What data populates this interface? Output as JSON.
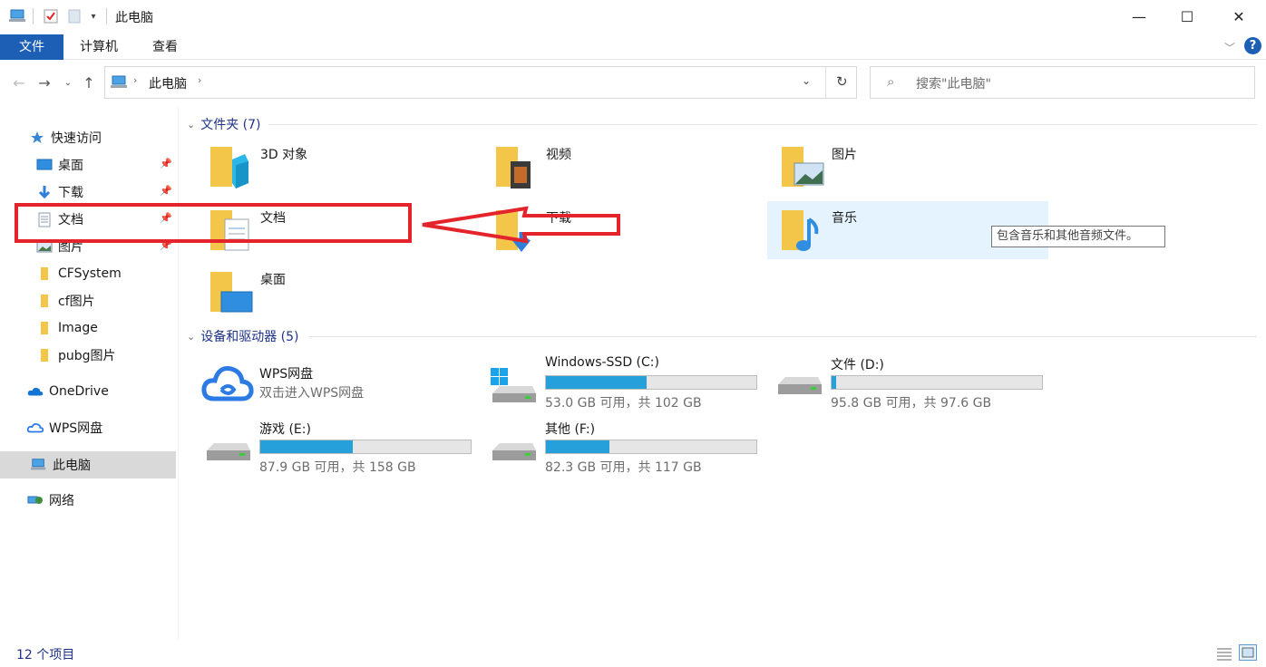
{
  "window": {
    "title": "此电脑",
    "controls": {
      "minimize": "—",
      "maximize": "☐",
      "close": "✕"
    }
  },
  "ribbon": {
    "tabs": [
      "文件",
      "计算机",
      "查看"
    ],
    "help": "?"
  },
  "address": {
    "path": "此电脑",
    "search_placeholder": "搜索\"此电脑\""
  },
  "sidebar": {
    "quick_access": "快速访问",
    "pinned": [
      "桌面",
      "下载",
      "文档",
      "图片"
    ],
    "folders": [
      "CFSystem",
      "cf图片",
      "Image",
      "pubg图片"
    ],
    "onedrive": "OneDrive",
    "wps": "WPS网盘",
    "this_pc": "此电脑",
    "network": "网络"
  },
  "content": {
    "folders_header": "文件夹 (7)",
    "folders": [
      "3D 对象",
      "视频",
      "图片",
      "文档",
      "下载",
      "音乐",
      "桌面"
    ],
    "devices_header": "设备和驱动器 (5)",
    "wps_drive": {
      "name": "WPS网盘",
      "sub": "双击进入WPS网盘"
    },
    "drives": [
      {
        "name": "Windows-SSD (C:)",
        "free": "53.0 GB 可用，共 102 GB",
        "used_fraction": 0.48
      },
      {
        "name": "文件 (D:)",
        "free": "95.8 GB 可用，共 97.6 GB",
        "used_fraction": 0.02
      },
      {
        "name": "游戏 (E:)",
        "free": "87.9 GB 可用，共 158 GB",
        "used_fraction": 0.44
      },
      {
        "name": "其他 (F:)",
        "free": "82.3 GB 可用，共 117 GB",
        "used_fraction": 0.3
      }
    ],
    "tooltip": "包含音乐和其他音频文件。"
  },
  "status": {
    "count": "12 个项目"
  },
  "colors": {
    "accent": "#1c5fb5",
    "annotation": "#e3242b",
    "drive_fill": "#26a0da"
  }
}
